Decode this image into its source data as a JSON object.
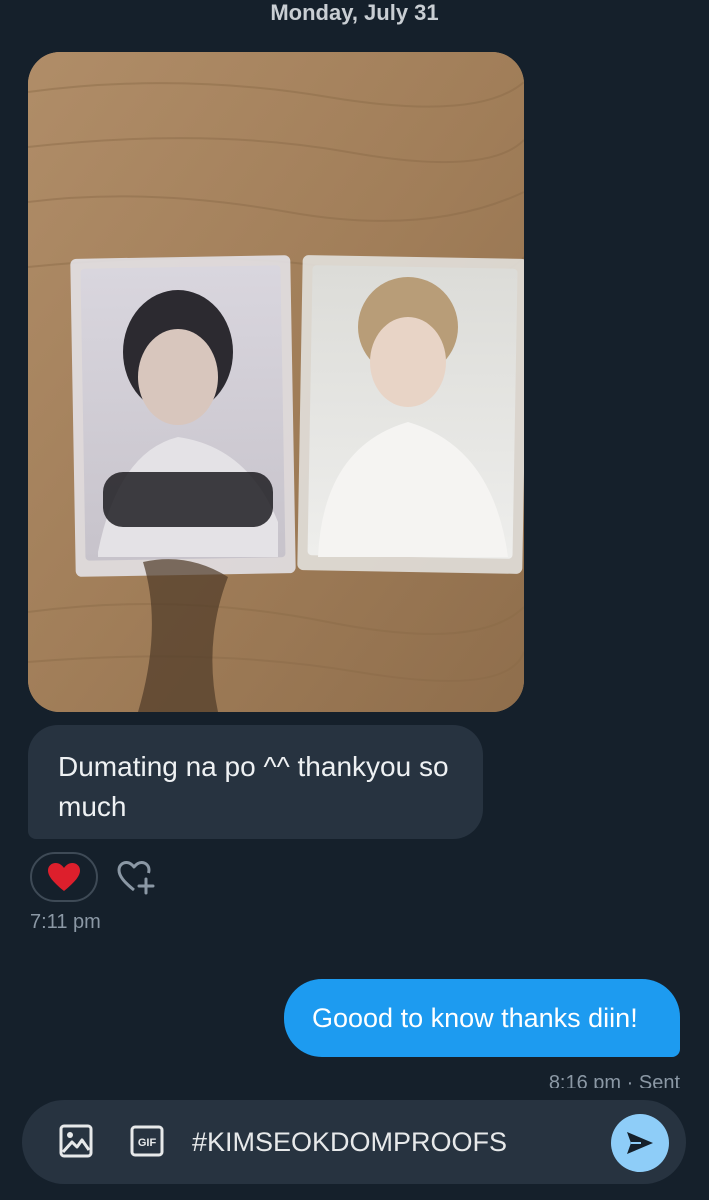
{
  "header": {
    "date": "Monday, July 31"
  },
  "messages": {
    "received": {
      "text": "Dumating na po ^^ thankyou so much",
      "time": "7:11 pm",
      "reaction_icon": "heart-icon"
    },
    "sent": {
      "text": "Goood to know thanks diin!",
      "status": "8:16 pm · Sent"
    }
  },
  "composer": {
    "value": "#KIMSEOKDOMPROOFS",
    "gif_label": "GIF",
    "icons": [
      "image-icon",
      "gif-icon",
      "send-icon"
    ]
  },
  "colors": {
    "background": "#15202b",
    "received_bubble": "#273340",
    "sent_bubble": "#1d9bf0",
    "send_button": "#8ecdf8"
  }
}
